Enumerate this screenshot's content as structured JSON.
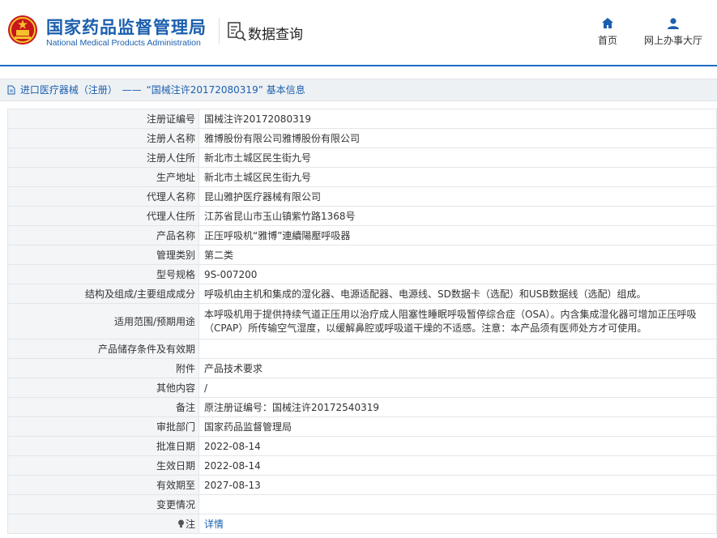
{
  "header": {
    "org_cn": "国家药品监督管理局",
    "org_en": "National Medical Products Administration",
    "query_title": "数据查询",
    "nav": [
      {
        "label": "首页",
        "icon": "home-icon"
      },
      {
        "label": "网上办事大厅",
        "icon": "user-icon"
      }
    ]
  },
  "breadcrumb": {
    "link": "进口医疗器械（注册）",
    "sep": "——",
    "current": "“国械注许20172080319” 基本信息"
  },
  "colors": {
    "brand_blue": "#1b5fae",
    "label_bg": "#f3f5f7",
    "crumb_bg": "#eef1f4"
  },
  "details": {
    "rows": [
      {
        "label": "注册证编号",
        "value": "国械注许20172080319"
      },
      {
        "label": "注册人名称",
        "value": "雅博股份有限公司雅博股份有限公司"
      },
      {
        "label": "注册人住所",
        "value": "新北市土城区民生街九号"
      },
      {
        "label": "生产地址",
        "value": "新北市土城区民生街九号"
      },
      {
        "label": "代理人名称",
        "value": "昆山雅护医疗器械有限公司"
      },
      {
        "label": "代理人住所",
        "value": "江苏省昆山市玉山镇紫竹路1368号"
      },
      {
        "label": "产品名称",
        "value": "正压呼吸机“雅博”連續陽壓呼吸器"
      },
      {
        "label": "管理类别",
        "value": "第二类"
      },
      {
        "label": "型号规格",
        "value": "9S-007200"
      },
      {
        "label": "结构及组成/主要组成成分",
        "value": "呼吸机由主机和集成的湿化器、电源适配器、电源线、SD数据卡（选配）和USB数据线（选配）组成。"
      },
      {
        "label": "适用范围/预期用途",
        "value": "本呼吸机用于提供持续气道正压用以治疗成人阻塞性睡眠呼吸暂停综合症（OSA）。内含集成湿化器可增加正压呼吸（CPAP）所传输空气湿度，以缓解鼻腔或呼吸道干燥的不适感。注意：本产品须有医师处方才可使用。"
      },
      {
        "label": "产品储存条件及有效期",
        "value": ""
      },
      {
        "label": "附件",
        "value": "产品技术要求"
      },
      {
        "label": "其他内容",
        "value": "/"
      },
      {
        "label": "备注",
        "value": "原注册证编号：国械注许20172540319"
      },
      {
        "label": "审批部门",
        "value": "国家药品监督管理局"
      },
      {
        "label": "批准日期",
        "value": "2022-08-14"
      },
      {
        "label": "生效日期",
        "value": "2022-08-14"
      },
      {
        "label": "有效期至",
        "value": "2027-08-13"
      },
      {
        "label": "变更情况",
        "value": ""
      },
      {
        "label": "注",
        "value": "详情"
      }
    ]
  }
}
